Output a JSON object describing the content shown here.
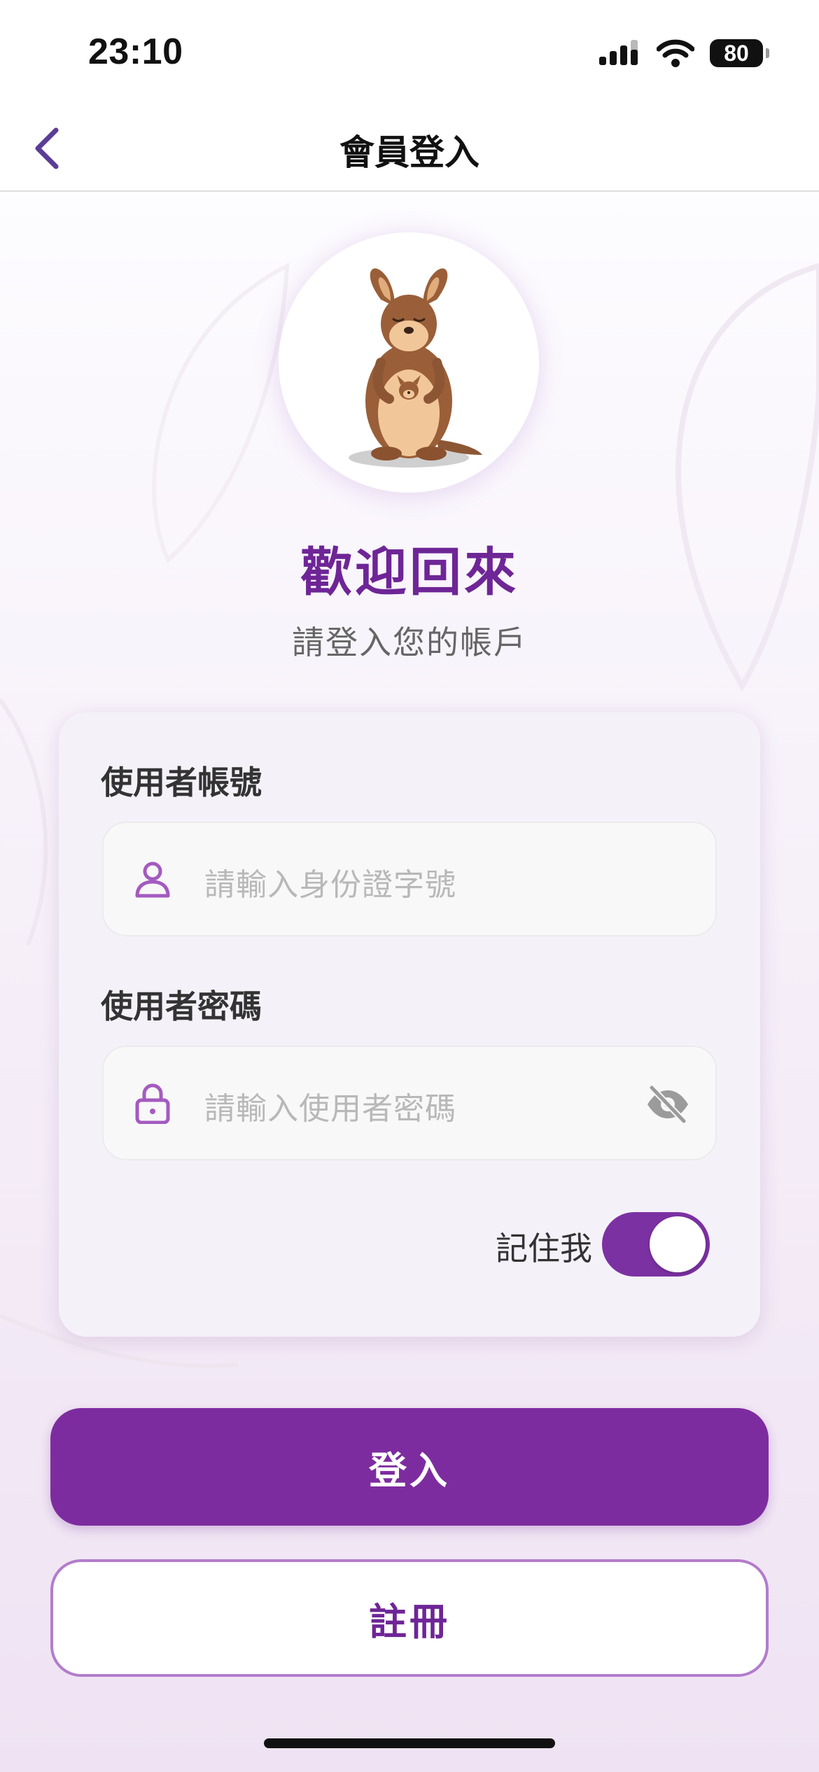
{
  "status_bar": {
    "time": "23:10",
    "battery_level": "80",
    "icons": [
      "signal-icon",
      "wifi-icon",
      "battery-icon"
    ]
  },
  "nav": {
    "back_icon": "chevron-left-icon",
    "title": "會員登入"
  },
  "hero": {
    "avatar_image": "kangaroo-mascot",
    "title": "歡迎回來",
    "subtitle": "請登入您的帳戶"
  },
  "form": {
    "username": {
      "label": "使用者帳號",
      "placeholder": "請輸入身份證字號",
      "value": "",
      "icon": "user-icon"
    },
    "password": {
      "label": "使用者密碼",
      "placeholder": "請輸入使用者密碼",
      "value": "",
      "icon": "lock-icon",
      "visibility_icon": "eye-off-icon"
    },
    "remember_me": {
      "label": "記住我",
      "checked": true
    }
  },
  "actions": {
    "login_label": "登入",
    "register_label": "註冊"
  },
  "colors": {
    "primary": "#7d2c9f",
    "title": "#6e2596",
    "accent_icon": "#a45ac0",
    "register_border": "#b27ccb"
  }
}
